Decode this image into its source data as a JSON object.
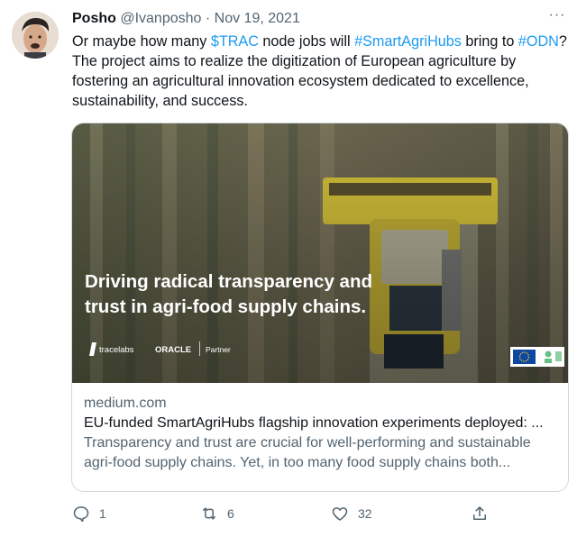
{
  "tweet": {
    "author_name": "Posho",
    "handle": "@Ivanposho",
    "separator": "·",
    "date": "Nov 19, 2021",
    "more": "···",
    "text_parts": {
      "p1": "Or maybe how many ",
      "cashtag": "$TRAC",
      "p2": " node jobs will ",
      "hashtag1": "#SmartAgriHubs",
      "p3": " bring to ",
      "hashtag2": "#ODN",
      "p4": "? The project aims to realize the digitization of European agriculture by fostering an agricultural innovation ecosystem dedicated to excellence, sustainability, and success."
    }
  },
  "card": {
    "image_headline_line1": "Driving radical transparency and",
    "image_headline_line2": "trust in agri-food supply chains.",
    "logo_tracelabs": "tracelabs",
    "logo_oracle": "ORACLE",
    "logo_partner": "Partner",
    "domain": "medium.com",
    "title": "EU-funded SmartAgriHubs flagship innovation experiments deployed: ...",
    "description": "Transparency and trust are crucial for well-performing and sustainable agri-food supply chains. Yet, in too many food supply chains both..."
  },
  "actions": {
    "reply_count": "1",
    "retweet_count": "6",
    "like_count": "32"
  },
  "colors": {
    "link": "#1d9bf0",
    "muted": "#536471",
    "harvester": "#d9c53a"
  }
}
